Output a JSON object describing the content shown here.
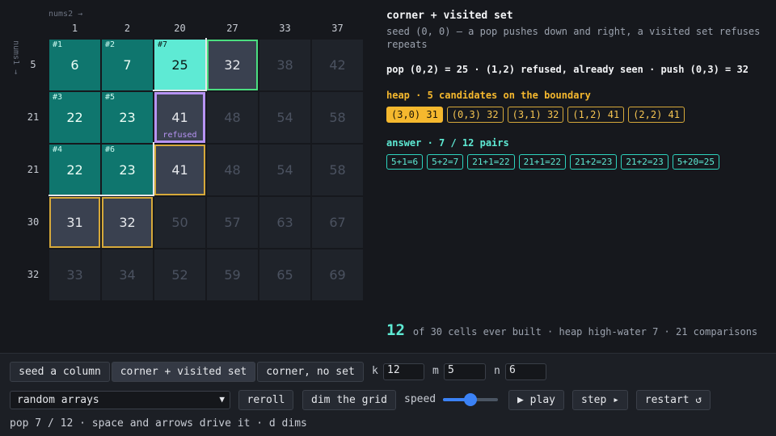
{
  "grid": {
    "axis_nums2": "nums2 →",
    "axis_nums1": "nums1 →",
    "nums2": [
      "1",
      "2",
      "20",
      "27",
      "33",
      "37"
    ],
    "nums1": [
      "5",
      "21",
      "21",
      "30",
      "32"
    ],
    "rows": [
      [
        {
          "v": "6",
          "s": "picked",
          "o": "#1"
        },
        {
          "v": "7",
          "s": "picked",
          "o": "#2"
        },
        {
          "v": "25",
          "s": "current",
          "o": "#7"
        },
        {
          "v": "32",
          "s": "nextpush"
        },
        {
          "v": "38",
          "s": ""
        },
        {
          "v": "42",
          "s": ""
        }
      ],
      [
        {
          "v": "22",
          "s": "picked",
          "o": "#3"
        },
        {
          "v": "23",
          "s": "picked",
          "o": "#5"
        },
        {
          "v": "41",
          "s": "refused",
          "t": "refused"
        },
        {
          "v": "48",
          "s": ""
        },
        {
          "v": "54",
          "s": ""
        },
        {
          "v": "58",
          "s": ""
        }
      ],
      [
        {
          "v": "22",
          "s": "picked",
          "o": "#4"
        },
        {
          "v": "23",
          "s": "picked",
          "o": "#6"
        },
        {
          "v": "41",
          "s": "cand"
        },
        {
          "v": "48",
          "s": ""
        },
        {
          "v": "54",
          "s": ""
        },
        {
          "v": "58",
          "s": ""
        }
      ],
      [
        {
          "v": "31",
          "s": "cand"
        },
        {
          "v": "32",
          "s": "cand"
        },
        {
          "v": "50",
          "s": ""
        },
        {
          "v": "57",
          "s": ""
        },
        {
          "v": "63",
          "s": ""
        },
        {
          "v": "67",
          "s": ""
        }
      ],
      [
        {
          "v": "33",
          "s": ""
        },
        {
          "v": "34",
          "s": ""
        },
        {
          "v": "52",
          "s": ""
        },
        {
          "v": "59",
          "s": ""
        },
        {
          "v": "65",
          "s": ""
        },
        {
          "v": "69",
          "s": ""
        }
      ]
    ]
  },
  "panel": {
    "title": "corner + visited set",
    "subtitle": "seed (0, 0) — a pop pushes down and right, a visited set refuses repeats",
    "status": "pop (0,2) = 25 · (1,2) refused, already seen · push (0,3) = 32",
    "heap_heading": "heap · 5 candidates on the boundary",
    "heap": [
      "(3,0) 31",
      "(0,3) 32",
      "(3,1) 32",
      "(1,2) 41",
      "(2,2) 41"
    ],
    "answer_heading": "answer · 7 / 12 pairs",
    "answers": [
      "5+1=6",
      "5+2=7",
      "21+1=22",
      "21+1=22",
      "21+2=23",
      "21+2=23",
      "5+20=25"
    ]
  },
  "summary": {
    "count": "12",
    "text": "of 30 cells ever built · heap high-water 7 · 21 comparisons"
  },
  "controls": {
    "mode_buttons": [
      "seed a column",
      "corner + visited set",
      "corner, no set"
    ],
    "k_label": "k",
    "k_value": "12",
    "m_label": "m",
    "m_value": "5",
    "n_label": "n",
    "n_value": "6",
    "array_select": "random arrays",
    "reroll": "reroll",
    "dim": "dim the grid",
    "speed_label": "speed",
    "speed_fraction": 0.5,
    "play": "▶ play",
    "step": "step ▸",
    "restart": "restart ↺"
  },
  "footer": "pop 7 / 12 · space and arrows drive it · d dims",
  "colors": {
    "picked": "#0f766e",
    "current": "#5eead4",
    "candidate_border": "#d6a93a",
    "next_push_border": "#4ade80",
    "refused_border": "#b794f4",
    "heap_top": "#f5b82e"
  }
}
